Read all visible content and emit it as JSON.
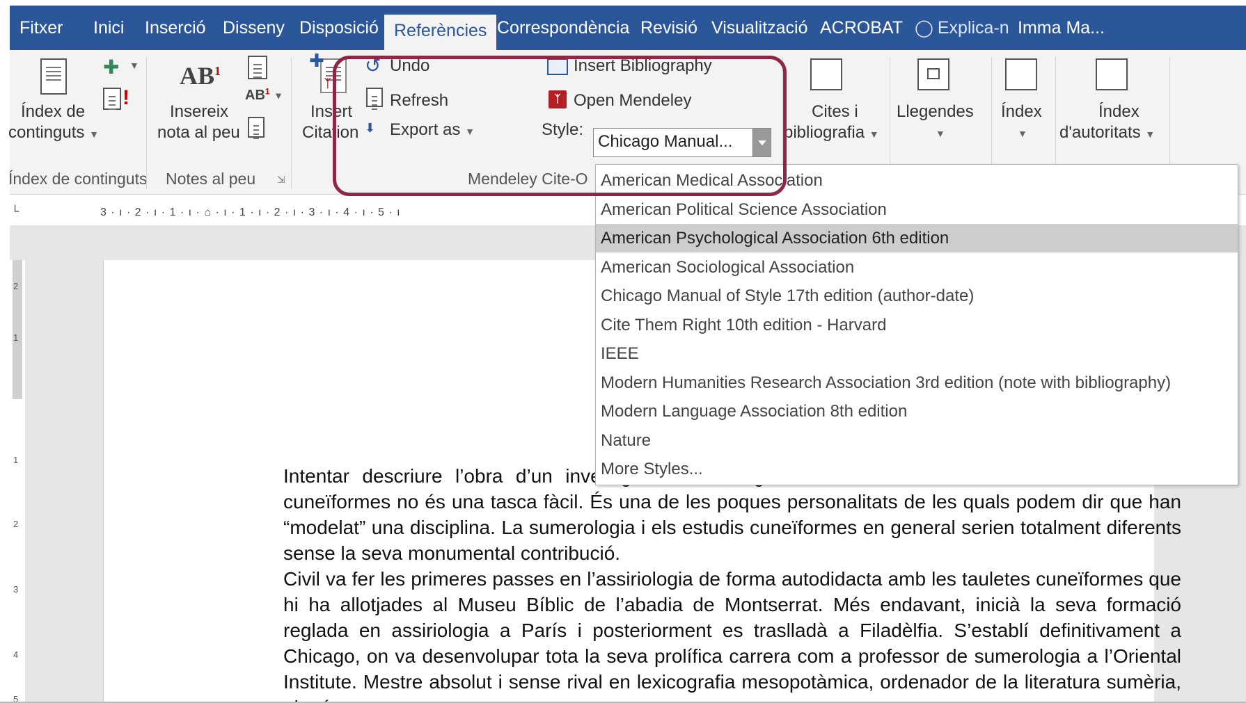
{
  "tabs": [
    {
      "label": "Fitxer",
      "active": false
    },
    {
      "label": "Inici",
      "active": false
    },
    {
      "label": "Inserció",
      "active": false
    },
    {
      "label": "Disseny",
      "active": false
    },
    {
      "label": "Disposició",
      "active": false
    },
    {
      "label": "Referències",
      "active": true
    },
    {
      "label": "Correspondència",
      "active": false
    },
    {
      "label": "Revisió",
      "active": false
    },
    {
      "label": "Visualització",
      "active": false
    },
    {
      "label": "ACROBAT",
      "active": false
    }
  ],
  "tell_me": "Explica-n",
  "user_name": "Imma Ma...",
  "ribbon": {
    "toc": {
      "line1": "Índex de",
      "line2": "continguts",
      "group": "Índex de continguts"
    },
    "footnote": {
      "line1": "Insereix",
      "line2": "nota al peu",
      "group": "Notes al peu"
    },
    "mendeley": {
      "insert_citation_line1": "Insert",
      "insert_citation_line2": "Citation",
      "undo": "Undo",
      "refresh": "Refresh",
      "export_as": "Export as",
      "insert_bibliography": "Insert Bibliography",
      "open_mendeley": "Open Mendeley",
      "style_label": "Style:",
      "style_value": "Chicago Manual...",
      "group": "Mendeley Cite-O"
    },
    "citations": {
      "line1": "Cites i",
      "line2": "bibliografia"
    },
    "captions": {
      "label": "Llegendes"
    },
    "index": {
      "label": "Índex"
    },
    "authorities": {
      "line1": "Índex",
      "line2": "d'autoritats"
    }
  },
  "ruler_text": "3 · ı · 2 · ı · 1 · ı · ⌂ · ı · 1 · ı · 2 · ı · 3 · ı · 4 · ı · 5 · ı",
  "vruler_numbers": [
    "2",
    "1",
    "1",
    "2",
    "3",
    "4",
    "5"
  ],
  "style_options": [
    {
      "label": "American Medical Association",
      "selected": false
    },
    {
      "label": "American Political Science Association",
      "selected": false
    },
    {
      "label": "American Psychological Association 6th edition",
      "selected": true
    },
    {
      "label": "American Sociological Association",
      "selected": false
    },
    {
      "label": "Chicago Manual of Style 17th edition (author-date)",
      "selected": false
    },
    {
      "label": "Cite Them Right 10th edition - Harvard",
      "selected": false
    },
    {
      "label": "IEEE",
      "selected": false
    },
    {
      "label": "Modern Humanities Research Association 3rd edition (note with bibliography)",
      "selected": false
    },
    {
      "label": "Modern Language Association 8th edition",
      "selected": false
    },
    {
      "label": "Nature",
      "selected": false
    },
    {
      "label": "More Styles...",
      "selected": false
    }
  ],
  "document": {
    "paragraph1": "Intentar descriure l’obra d’un investigador com Miguel Civil i la seva influència en els estudis cuneïformes no és una tasca fàcil. És una de les poques personalitats de les quals podem dir que han “modelat” una disciplina. La sumerologia i els estudis cuneïformes en general serien totalment diferents sense la seva monumental contribució.",
    "paragraph2": "Civil va fer les primeres passes en l’assiriologia de forma autodidacta amb les tauletes cuneïformes que hi ha allotjades al Museu Bíblic de l’abadia de Montserrat. Més endavant, inicià la seva formació reglada en assiriologia a París i posteriorment es traslladà a Filadèlfia. S’establí definitivament a Chicago, on va desenvolupar tota la seva prolífica carrera com a professor de sumerologia a l’Oriental Institute. Mestre absolut i sense rival en lexicografia mesopotàmica, ordenador de la literatura sumèria, el més gran expert en"
  },
  "colors": {
    "word_blue": "#2b579a",
    "highlight": "#8e2743",
    "mendeley_red": "#b21f24"
  }
}
